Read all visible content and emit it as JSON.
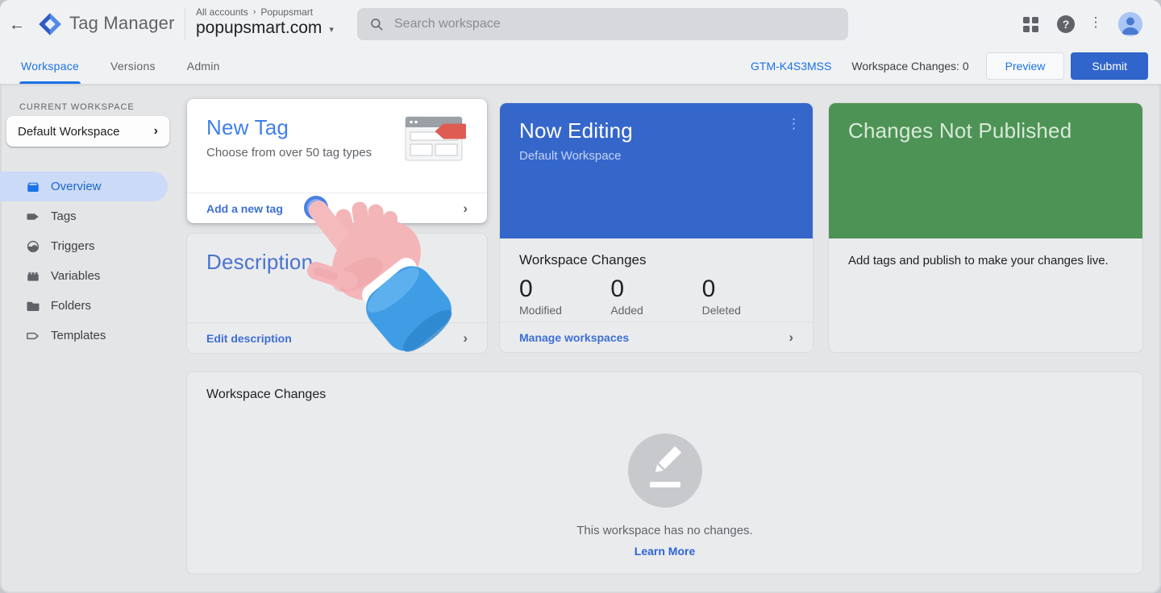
{
  "header": {
    "app_title": "Tag Manager",
    "breadcrumb_root": "All accounts",
    "breadcrumb_account": "Popupsmart",
    "container_name": "popupsmart.com",
    "search_placeholder": "Search workspace"
  },
  "tabs": {
    "workspace": "Workspace",
    "versions": "Versions",
    "admin": "Admin",
    "container_id": "GTM-K4S3MSS",
    "changes_summary": "Workspace Changes: 0",
    "preview_label": "Preview",
    "submit_label": "Submit"
  },
  "sidebar": {
    "section_label": "CURRENT WORKSPACE",
    "workspace_name": "Default Workspace",
    "items": [
      {
        "label": "Overview",
        "active": true
      },
      {
        "label": "Tags",
        "active": false
      },
      {
        "label": "Triggers",
        "active": false
      },
      {
        "label": "Variables",
        "active": false
      },
      {
        "label": "Folders",
        "active": false
      },
      {
        "label": "Templates",
        "active": false
      }
    ]
  },
  "cards": {
    "new_tag": {
      "title": "New Tag",
      "subtitle": "Choose from over 50 tag types",
      "action": "Add a new tag"
    },
    "description": {
      "title": "Description",
      "action": "Edit description"
    },
    "now_editing": {
      "title": "Now Editing",
      "subtitle": "Default Workspace",
      "section_title": "Workspace Changes",
      "stats": [
        {
          "value": "0",
          "label": "Modified"
        },
        {
          "value": "0",
          "label": "Added"
        },
        {
          "value": "0",
          "label": "Deleted"
        }
      ],
      "action": "Manage workspaces"
    },
    "changes_not_published": {
      "title": "Changes Not Published",
      "body": "Add tags and publish to make your changes live."
    },
    "workspace_changes": {
      "title": "Workspace Changes",
      "empty_text": "This workspace has no changes.",
      "learn_more": "Learn More"
    }
  },
  "icons": {
    "back": "←",
    "breadcrumb_chevron": "›",
    "caret_down": "▾",
    "help": "?",
    "kebab": "⋮",
    "chevron_right": "›"
  },
  "colors": {
    "accent_blue": "#1a73e8",
    "link_blue": "#3d6fd6",
    "now_editing_header": "#3567cb",
    "changes_not_published_header": "#4d9355",
    "submit_bg": "#3065cb",
    "selected_nav_pill": "#cbdaf6"
  }
}
